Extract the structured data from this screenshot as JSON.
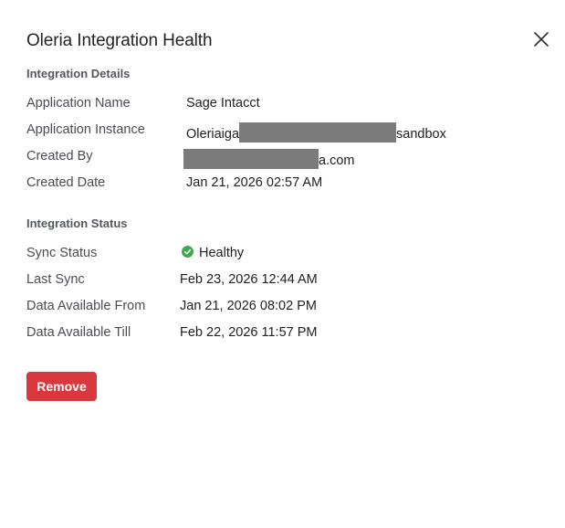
{
  "modal": {
    "title": "Oleria Integration Health",
    "close_icon": "close-icon",
    "remove_label": "Remove"
  },
  "details": {
    "heading": "Integration Details",
    "application_name_label": "Application Name",
    "application_name_value": "Sage Intacct",
    "application_instance_label": "Application Instance",
    "application_instance_prefix": "Oleriaiga",
    "application_instance_suffix": "sandbox",
    "created_by_label": "Created By",
    "created_by_suffix": "a.com",
    "created_date_label": "Created Date",
    "created_date_value": "Jan 21, 2026 02:57 AM"
  },
  "status": {
    "heading": "Integration Status",
    "sync_status_label": "Sync Status",
    "sync_status_value": "Healthy",
    "sync_status_color": "#3ea84f",
    "last_sync_label": "Last Sync",
    "last_sync_value": "Feb 23, 2026 12:44 AM",
    "available_from_label": "Data Available From",
    "available_from_value": "Jan 21, 2026 08:02 PM",
    "available_till_label": "Data Available Till",
    "available_till_value": "Feb 22, 2026 11:57 PM"
  },
  "colors": {
    "remove_button": "#d9393e",
    "redaction": "#7b7b7b"
  }
}
